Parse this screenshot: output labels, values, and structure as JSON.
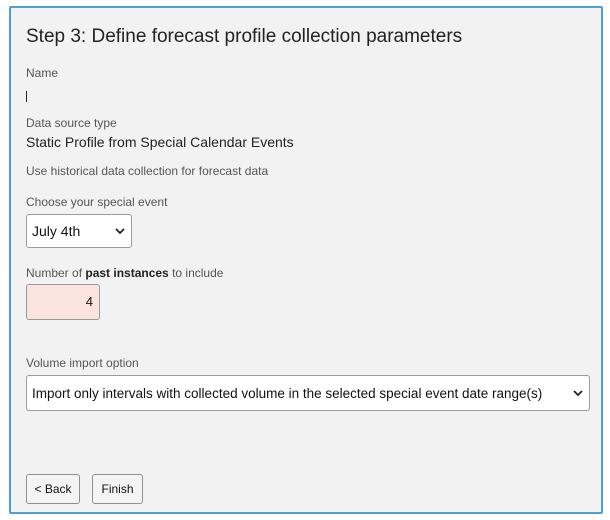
{
  "wizard": {
    "title": "Step 3: Define forecast profile collection parameters",
    "name_label": "Name",
    "name_value": "",
    "data_source_label": "Data source type",
    "data_source_value": "Static Profile from Special Calendar Events",
    "historical_note": "Use historical data collection for forecast data",
    "special_event_label": "Choose your special event",
    "special_event_selected": "July 4th",
    "past_instances_label_prefix": "Number of ",
    "past_instances_label_bold": "past instances",
    "past_instances_label_suffix": " to include",
    "past_instances_value": "4",
    "volume_import_label": "Volume import option",
    "volume_import_selected": "Import only intervals with collected volume in the selected special event date range(s)",
    "back_label": "< Back",
    "finish_label": "Finish"
  },
  "colors": {
    "panel_border": "#4d9fd6",
    "panel_background": "#f2f2f2",
    "invalid_input_background": "#fbe3e0"
  },
  "icons": {
    "dropdown": "chevron-down-icon"
  }
}
